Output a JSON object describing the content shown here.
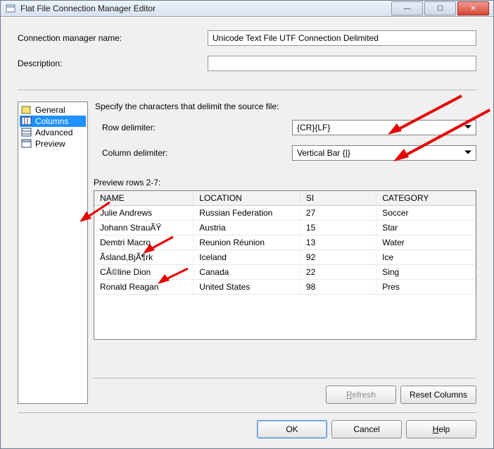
{
  "window": {
    "title": "Flat File Connection Manager Editor"
  },
  "form": {
    "name_label_html": "Connection manager name:",
    "name_value": "Unicode Text File UTF Connection Delimited",
    "desc_label_html": "Description:",
    "desc_value": ""
  },
  "nav": {
    "items": [
      {
        "label": "General",
        "icon": "general-icon",
        "selected": false
      },
      {
        "label": "Columns",
        "icon": "columns-icon",
        "selected": true
      },
      {
        "label": "Advanced",
        "icon": "advanced-icon",
        "selected": false
      },
      {
        "label": "Preview",
        "icon": "preview-icon",
        "selected": false
      }
    ]
  },
  "delimiters": {
    "intro": "Specify the characters that delimit the source file:",
    "row_label": "Row delimiter:",
    "row_value": "{CR}{LF}",
    "col_label": "Column delimiter:",
    "col_value": "Vertical Bar {|}"
  },
  "preview": {
    "label": "Preview rows 2-7:",
    "columns": [
      "NAME",
      "LOCATION",
      "SI",
      "CATEGORY"
    ],
    "rows": [
      [
        "Julie Andrews",
        "Russian Federation",
        "27",
        "Soccer"
      ],
      [
        "Johann StrauÃŸ",
        "Austria",
        "15",
        "Star"
      ],
      [
        "Demtri Macro",
        "Reunion Réunion",
        "13",
        "Water"
      ],
      [
        "Ãsland,BjÃ¶rk",
        "Iceland",
        "92",
        "Ice"
      ],
      [
        "CÃ©line Dion",
        "Canada",
        "22",
        "Sing"
      ],
      [
        "Ronald Reagan",
        "United States",
        "98",
        "Pres"
      ]
    ]
  },
  "buttons": {
    "refresh": "Refresh",
    "reset_columns": "Reset Columns",
    "ok": "OK",
    "cancel": "Cancel",
    "help": "Help"
  }
}
